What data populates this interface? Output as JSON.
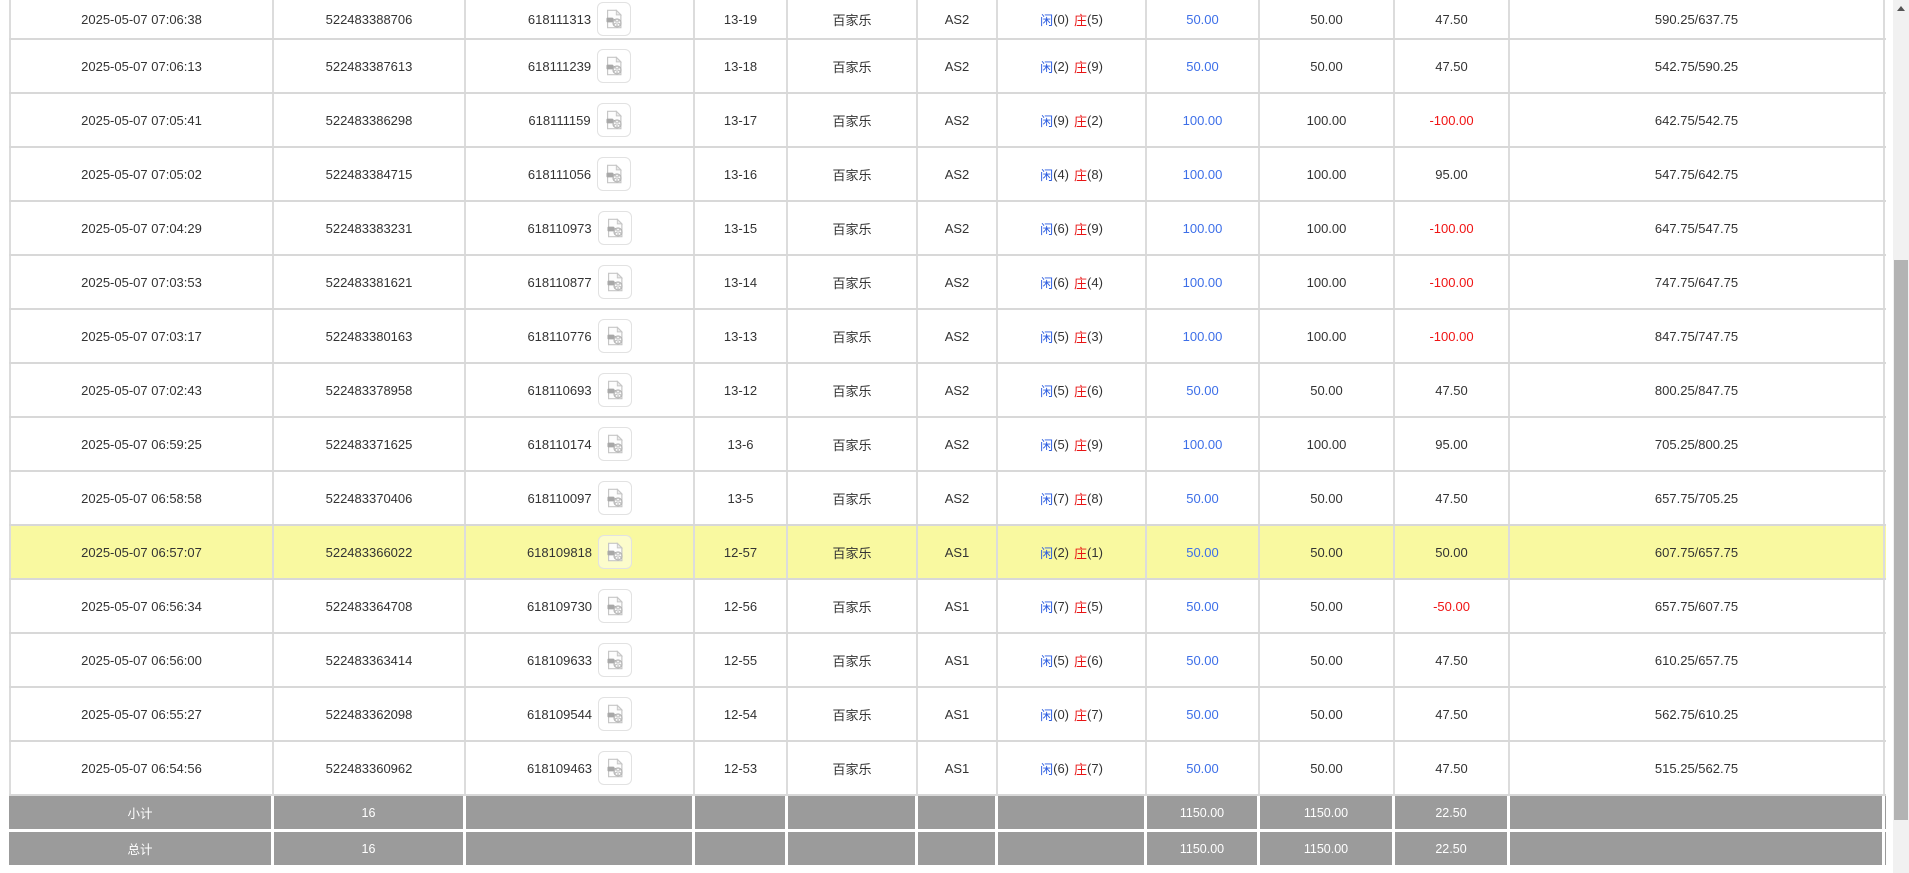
{
  "colors": {
    "accent_blue": "#3d6fe8",
    "player_blue": "#2b5ce0",
    "banker_red": "#e81414",
    "loss_red": "#f01414",
    "highlight_yellow": "#f9f9a0",
    "footer_gray": "#9b9b9b",
    "border_gray": "#d8d8d8",
    "border_gray_v": "#dcdcdc",
    "text_dark": "#333333"
  },
  "icons": {
    "video_icon": "video-replay-file-icon",
    "up_arrow": "scroll-up-arrow"
  },
  "rows": [
    {
      "time": "2025-05-07 07:06:38",
      "bet_id": "522483388706",
      "round_id": "618111313",
      "round_no": "13-19",
      "game": "百家乐",
      "table_name": "AS2",
      "player_label": "闲",
      "player_score": "(0)",
      "banker_label": "庄",
      "banker_score": "(5)",
      "bet_amount": "50.00",
      "valid_amount": "50.00",
      "win_loss": "47.50",
      "balance": "590.25/637.75",
      "highlighted": false
    },
    {
      "time": "2025-05-07 07:06:13",
      "bet_id": "522483387613",
      "round_id": "618111239",
      "round_no": "13-18",
      "game": "百家乐",
      "table_name": "AS2",
      "player_label": "闲",
      "player_score": "(2)",
      "banker_label": "庄",
      "banker_score": "(9)",
      "bet_amount": "50.00",
      "valid_amount": "50.00",
      "win_loss": "47.50",
      "balance": "542.75/590.25",
      "highlighted": false
    },
    {
      "time": "2025-05-07 07:05:41",
      "bet_id": "522483386298",
      "round_id": "618111159",
      "round_no": "13-17",
      "game": "百家乐",
      "table_name": "AS2",
      "player_label": "闲",
      "player_score": "(9)",
      "banker_label": "庄",
      "banker_score": "(2)",
      "bet_amount": "100.00",
      "valid_amount": "100.00",
      "win_loss": "-100.00",
      "balance": "642.75/542.75",
      "highlighted": false
    },
    {
      "time": "2025-05-07 07:05:02",
      "bet_id": "522483384715",
      "round_id": "618111056",
      "round_no": "13-16",
      "game": "百家乐",
      "table_name": "AS2",
      "player_label": "闲",
      "player_score": "(4)",
      "banker_label": "庄",
      "banker_score": "(8)",
      "bet_amount": "100.00",
      "valid_amount": "100.00",
      "win_loss": "95.00",
      "balance": "547.75/642.75",
      "highlighted": false
    },
    {
      "time": "2025-05-07 07:04:29",
      "bet_id": "522483383231",
      "round_id": "618110973",
      "round_no": "13-15",
      "game": "百家乐",
      "table_name": "AS2",
      "player_label": "闲",
      "player_score": "(6)",
      "banker_label": "庄",
      "banker_score": "(9)",
      "bet_amount": "100.00",
      "valid_amount": "100.00",
      "win_loss": "-100.00",
      "balance": "647.75/547.75",
      "highlighted": false
    },
    {
      "time": "2025-05-07 07:03:53",
      "bet_id": "522483381621",
      "round_id": "618110877",
      "round_no": "13-14",
      "game": "百家乐",
      "table_name": "AS2",
      "player_label": "闲",
      "player_score": "(6)",
      "banker_label": "庄",
      "banker_score": "(4)",
      "bet_amount": "100.00",
      "valid_amount": "100.00",
      "win_loss": "-100.00",
      "balance": "747.75/647.75",
      "highlighted": false
    },
    {
      "time": "2025-05-07 07:03:17",
      "bet_id": "522483380163",
      "round_id": "618110776",
      "round_no": "13-13",
      "game": "百家乐",
      "table_name": "AS2",
      "player_label": "闲",
      "player_score": "(5)",
      "banker_label": "庄",
      "banker_score": "(3)",
      "bet_amount": "100.00",
      "valid_amount": "100.00",
      "win_loss": "-100.00",
      "balance": "847.75/747.75",
      "highlighted": false
    },
    {
      "time": "2025-05-07 07:02:43",
      "bet_id": "522483378958",
      "round_id": "618110693",
      "round_no": "13-12",
      "game": "百家乐",
      "table_name": "AS2",
      "player_label": "闲",
      "player_score": "(5)",
      "banker_label": "庄",
      "banker_score": "(6)",
      "bet_amount": "50.00",
      "valid_amount": "50.00",
      "win_loss": "47.50",
      "balance": "800.25/847.75",
      "highlighted": false
    },
    {
      "time": "2025-05-07 06:59:25",
      "bet_id": "522483371625",
      "round_id": "618110174",
      "round_no": "13-6",
      "game": "百家乐",
      "table_name": "AS2",
      "player_label": "闲",
      "player_score": "(5)",
      "banker_label": "庄",
      "banker_score": "(9)",
      "bet_amount": "100.00",
      "valid_amount": "100.00",
      "win_loss": "95.00",
      "balance": "705.25/800.25",
      "highlighted": false
    },
    {
      "time": "2025-05-07 06:58:58",
      "bet_id": "522483370406",
      "round_id": "618110097",
      "round_no": "13-5",
      "game": "百家乐",
      "table_name": "AS2",
      "player_label": "闲",
      "player_score": "(7)",
      "banker_label": "庄",
      "banker_score": "(8)",
      "bet_amount": "50.00",
      "valid_amount": "50.00",
      "win_loss": "47.50",
      "balance": "657.75/705.25",
      "highlighted": false
    },
    {
      "time": "2025-05-07 06:57:07",
      "bet_id": "522483366022",
      "round_id": "618109818",
      "round_no": "12-57",
      "game": "百家乐",
      "table_name": "AS1",
      "player_label": "闲",
      "player_score": "(2)",
      "banker_label": "庄",
      "banker_score": "(1)",
      "bet_amount": "50.00",
      "valid_amount": "50.00",
      "win_loss": "50.00",
      "balance": "607.75/657.75",
      "highlighted": true
    },
    {
      "time": "2025-05-07 06:56:34",
      "bet_id": "522483364708",
      "round_id": "618109730",
      "round_no": "12-56",
      "game": "百家乐",
      "table_name": "AS1",
      "player_label": "闲",
      "player_score": "(7)",
      "banker_label": "庄",
      "banker_score": "(5)",
      "bet_amount": "50.00",
      "valid_amount": "50.00",
      "win_loss": "-50.00",
      "balance": "657.75/607.75",
      "highlighted": false
    },
    {
      "time": "2025-05-07 06:56:00",
      "bet_id": "522483363414",
      "round_id": "618109633",
      "round_no": "12-55",
      "game": "百家乐",
      "table_name": "AS1",
      "player_label": "闲",
      "player_score": "(5)",
      "banker_label": "庄",
      "banker_score": "(6)",
      "bet_amount": "50.00",
      "valid_amount": "50.00",
      "win_loss": "47.50",
      "balance": "610.25/657.75",
      "highlighted": false
    },
    {
      "time": "2025-05-07 06:55:27",
      "bet_id": "522483362098",
      "round_id": "618109544",
      "round_no": "12-54",
      "game": "百家乐",
      "table_name": "AS1",
      "player_label": "闲",
      "player_score": "(0)",
      "banker_label": "庄",
      "banker_score": "(7)",
      "bet_amount": "50.00",
      "valid_amount": "50.00",
      "win_loss": "47.50",
      "balance": "562.75/610.25",
      "highlighted": false
    },
    {
      "time": "2025-05-07 06:54:56",
      "bet_id": "522483360962",
      "round_id": "618109463",
      "round_no": "12-53",
      "game": "百家乐",
      "table_name": "AS1",
      "player_label": "闲",
      "player_score": "(6)",
      "banker_label": "庄",
      "banker_score": "(7)",
      "bet_amount": "50.00",
      "valid_amount": "50.00",
      "win_loss": "47.50",
      "balance": "515.25/562.75",
      "highlighted": false
    }
  ],
  "footer": {
    "subtotal": {
      "label": "小计",
      "count": "16",
      "bet_total": "1150.00",
      "valid_total": "1150.00",
      "win_loss_total": "22.50"
    },
    "total": {
      "label": "总计",
      "count": "16",
      "bet_total": "1150.00",
      "valid_total": "1150.00",
      "win_loss_total": "22.50"
    }
  }
}
